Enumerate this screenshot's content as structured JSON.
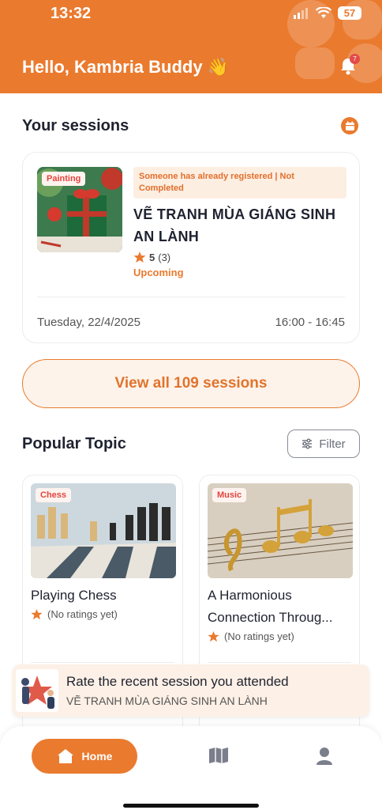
{
  "status": {
    "time": "13:32",
    "battery": "57"
  },
  "header": {
    "greeting": "Hello, Kambria Buddy 👋",
    "notification_count": "7"
  },
  "sessions": {
    "title": "Your sessions",
    "card": {
      "tag": "Painting",
      "status_tag": "Someone has already registered | Not Completed",
      "name": "VẼ TRANH MÙA GIÁNG SINH AN LÀNH",
      "rating": "5",
      "rating_count": "(3)",
      "state": "Upcoming",
      "date": "Tuesday, 22/4/2025",
      "time": "16:00 - 16:45"
    },
    "view_all": "View all 109 sessions"
  },
  "popular": {
    "title": "Popular Topic",
    "filter_label": "Filter",
    "topics": [
      {
        "tag": "Chess",
        "title": "Playing Chess",
        "rating": "(No ratings yet)"
      },
      {
        "tag": "Music",
        "title": "A Harmonious Connection Throug...",
        "rating": "(No ratings yet)"
      }
    ]
  },
  "rate_banner": {
    "title": "Rate the recent session you attended",
    "subtitle": "VẼ TRANH MÙA GIÁNG SINH AN LÀNH"
  },
  "nav": {
    "home_label": "Home"
  },
  "colors": {
    "accent": "#ea7a2e",
    "tag_red": "#e0453f"
  }
}
